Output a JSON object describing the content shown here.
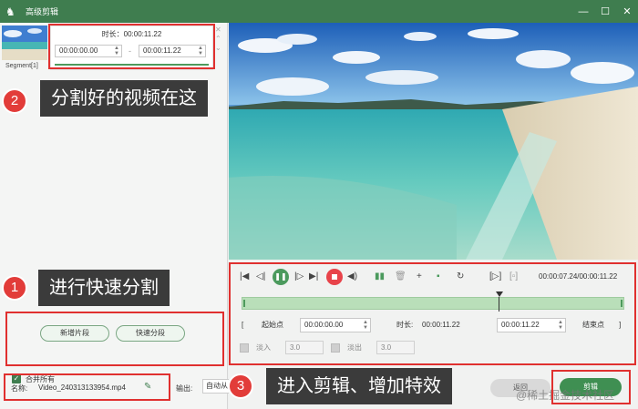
{
  "window": {
    "title": "高级剪辑",
    "controls": [
      "—",
      "☐",
      "✕"
    ]
  },
  "segment_panel": {
    "label": "Segment[1]",
    "duration_text": "时长：00:00:11.22",
    "start_time": "00:00:00.00",
    "end_time": "00:00:11.22",
    "separator": "-"
  },
  "left_buttons": {
    "new_segment": "新增片段",
    "quick_split": "快速分段",
    "merge_all": "合并所有"
  },
  "file": {
    "name_label": "名称:",
    "name_value": "Video_240313133954.mp4",
    "output_label": "输出:",
    "output_value": "自动从"
  },
  "playback": {
    "time_readout": "00:00:07.24/00:00:11.22"
  },
  "range": {
    "start_label": "起始点",
    "start_value": "00:00:00.00",
    "duration_label": "时长:",
    "duration_value": "00:00:11.22",
    "end_value": "00:00:11.22",
    "end_label": "结束点",
    "bracket_left": "[",
    "bracket_right": "]"
  },
  "fade": {
    "in_label": "淡入",
    "in_value": "3.0",
    "out_label": "淡出",
    "out_value": "3.0"
  },
  "footer_buttons": {
    "back": "返回",
    "edit": "剪辑"
  },
  "annotations": {
    "tip1": {
      "num": "1",
      "text": "进行快速分割"
    },
    "tip2": {
      "num": "2",
      "text": "分割好的视频在这"
    },
    "tip3": {
      "num": "3",
      "text": "进入剪辑、增加特效"
    }
  },
  "watermark": "@稀土掘金技术社区",
  "colors": {
    "titlebar": "#3f7d4f",
    "accent_green": "#4b9a5d",
    "stop_red": "#e8434a",
    "annotation_red": "#e0302f"
  }
}
